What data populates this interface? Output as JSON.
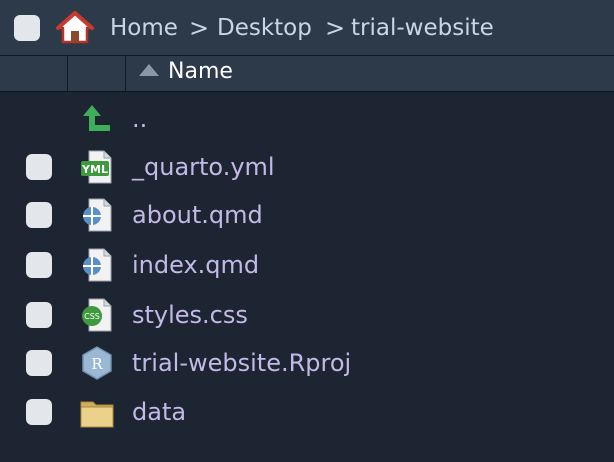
{
  "breadcrumb": {
    "items": [
      "Home",
      "Desktop",
      "trial-website"
    ],
    "separator": ">"
  },
  "header": {
    "name_column": "Name",
    "sort_icon": "sort-ascending-icon"
  },
  "files": [
    {
      "name": "..",
      "icon": "parent-directory-icon"
    },
    {
      "name": "_quarto.yml",
      "icon": "yml-file-icon"
    },
    {
      "name": "about.qmd",
      "icon": "qmd-file-icon"
    },
    {
      "name": "index.qmd",
      "icon": "qmd-file-icon"
    },
    {
      "name": "styles.css",
      "icon": "css-file-icon"
    },
    {
      "name": "trial-website.Rproj",
      "icon": "rproj-file-icon"
    },
    {
      "name": "data",
      "icon": "folder-icon"
    }
  ],
  "colors": {
    "background": "#1c2531",
    "bar": "#2c3a4a",
    "file_name": "#c3b9e6",
    "accent_green": "#3fae5a"
  }
}
